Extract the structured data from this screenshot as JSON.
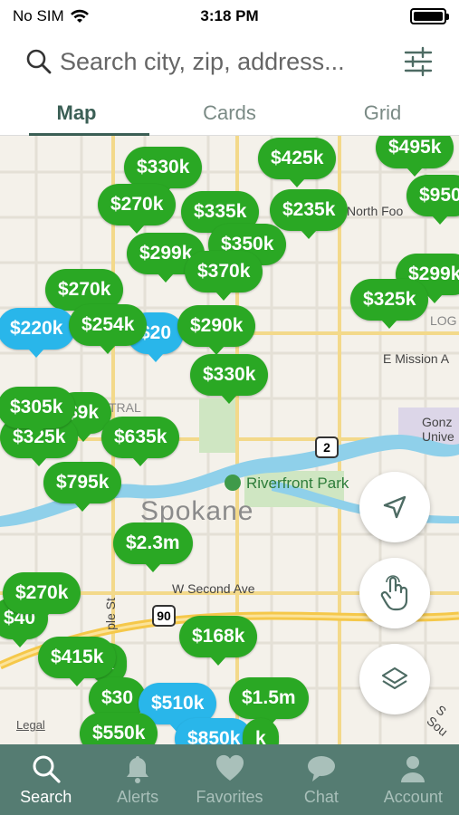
{
  "status_bar": {
    "carrier": "No SIM",
    "time": "3:18 PM"
  },
  "search": {
    "placeholder": "Search city, zip, address..."
  },
  "tabs": [
    {
      "label": "Map",
      "active": true
    },
    {
      "label": "Cards",
      "active": false
    },
    {
      "label": "Grid",
      "active": false
    }
  ],
  "map": {
    "city_label": "Spokane",
    "poi_label": "Riverfront Park",
    "street_labels": [
      "W Second Ave",
      "North Foo",
      "E Mission A",
      "LOG",
      "TRAL",
      "Gonz",
      "Unive",
      "S Sou",
      "ple St"
    ],
    "highway_shields": [
      "2",
      "90"
    ],
    "legal_label": "Legal",
    "pins": [
      {
        "price": "$330k",
        "color": "green"
      },
      {
        "price": "$425k",
        "color": "green"
      },
      {
        "price": "$495k",
        "color": "green"
      },
      {
        "price": "$270k",
        "color": "green"
      },
      {
        "price": "$335k",
        "color": "green"
      },
      {
        "price": "$235k",
        "color": "green"
      },
      {
        "price": "$950",
        "color": "green"
      },
      {
        "price": "$299k",
        "color": "green"
      },
      {
        "price": "$350k",
        "color": "green"
      },
      {
        "price": "$370k",
        "color": "green"
      },
      {
        "price": "$299k",
        "color": "green"
      },
      {
        "price": "$325k",
        "color": "green"
      },
      {
        "price": "$270k",
        "color": "green"
      },
      {
        "price": "$220k",
        "color": "blue"
      },
      {
        "price": "$254k",
        "color": "green"
      },
      {
        "price": "$20",
        "color": "blue"
      },
      {
        "price": "$290k",
        "color": "green"
      },
      {
        "price": "$330k",
        "color": "green"
      },
      {
        "price": "$305k",
        "color": "green"
      },
      {
        "price": "$325k",
        "color": "green"
      },
      {
        "price": "$9k",
        "color": "green"
      },
      {
        "price": "$635k",
        "color": "green"
      },
      {
        "price": "$795k",
        "color": "green"
      },
      {
        "price": "$2.3m",
        "color": "green"
      },
      {
        "price": "$270k",
        "color": "green"
      },
      {
        "price": "$40",
        "color": "green"
      },
      {
        "price": "$168k",
        "color": "green"
      },
      {
        "price": "$415k",
        "color": "green"
      },
      {
        "price": "k",
        "color": "green"
      },
      {
        "price": "$30",
        "color": "green"
      },
      {
        "price": "$510k",
        "color": "blue"
      },
      {
        "price": "$1.5m",
        "color": "green"
      },
      {
        "price": "$550k",
        "color": "green"
      },
      {
        "price": "$850k",
        "color": "blue"
      },
      {
        "price": "k",
        "color": "green"
      }
    ]
  },
  "bottom_nav": [
    {
      "label": "Search",
      "icon": "search-icon",
      "active": true
    },
    {
      "label": "Alerts",
      "icon": "bell-icon",
      "active": false
    },
    {
      "label": "Favorites",
      "icon": "heart-icon",
      "active": false
    },
    {
      "label": "Chat",
      "icon": "chat-icon",
      "active": false
    },
    {
      "label": "Account",
      "icon": "person-icon",
      "active": false
    }
  ],
  "colors": {
    "pin_green": "#2aa824",
    "pin_blue": "#29b6ea",
    "nav_bg": "#557c72",
    "accent": "#3b5f55"
  }
}
